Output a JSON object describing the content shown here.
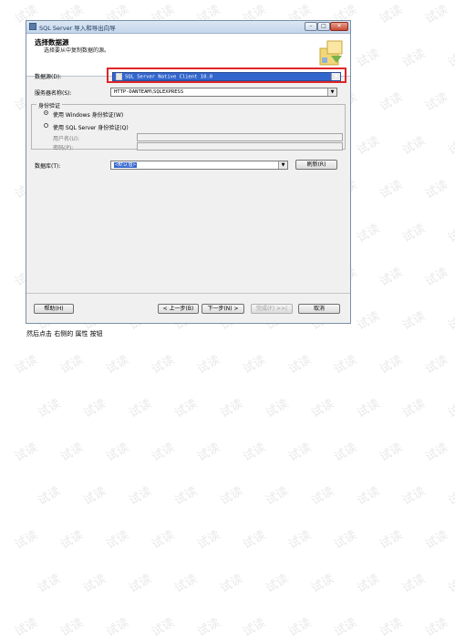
{
  "window": {
    "title": "SQL Server 导入和导出向导",
    "controls": {
      "minimize": "–",
      "maximize": "□",
      "close": "✕"
    }
  },
  "header": {
    "title": "选择数据源",
    "subtitle": "选择要从中复制数据的源。"
  },
  "form": {
    "datasource_label": "数据源(D):",
    "datasource_value": "SQL Server Native Client 10.0",
    "server_label": "服务器名称(S):",
    "server_value": "HTTP-DANTEAM\\SQLEXPRESS",
    "auth_legend": "身份验证",
    "auth_windows": "使用 Windows 身份验证(W)",
    "auth_sql": "使用 SQL Server 身份验证(Q)",
    "auth_selected": "windows",
    "username_label": "用户名(U):",
    "password_label": "密码(P):",
    "database_label": "数据库(T):",
    "database_value": "<默认值>",
    "refresh_button": "刷新(R)"
  },
  "footer": {
    "help_button": "帮助(H)",
    "back_button": "< 上一步(B)",
    "next_button": "下一步(N) >",
    "finish_button": "完成(F) >>|",
    "cancel_button": "取消"
  },
  "caption": "然后点击 右侧的 属性 按钮",
  "watermark": "试读",
  "colors": {
    "highlight_border": "#e0262a",
    "selection": "#3366cc"
  }
}
